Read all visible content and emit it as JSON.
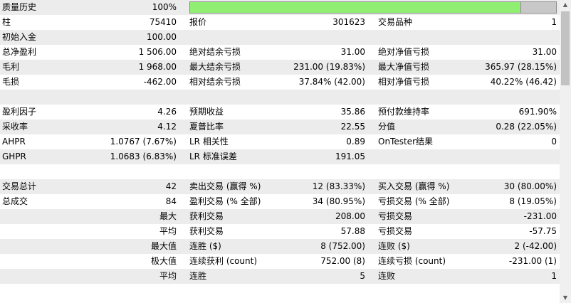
{
  "quality": {
    "label": "质量历史",
    "value": "100%",
    "fill": 0.905
  },
  "rows": [
    {
      "c1": [
        "柱",
        "75410"
      ],
      "c2": [
        "报价",
        "301623"
      ],
      "c3": [
        "交易品种",
        "1"
      ]
    },
    {
      "c1": [
        "初始入金",
        "100.00"
      ],
      "c2": [
        "",
        ""
      ],
      "c3": [
        "",
        ""
      ]
    },
    {
      "c1": [
        "总净盈利",
        "1 506.00"
      ],
      "c2": [
        "绝对结余亏损",
        "31.00"
      ],
      "c3": [
        "绝对净值亏损",
        "31.00"
      ]
    },
    {
      "c1": [
        "毛利",
        "1 968.00"
      ],
      "c2": [
        "最大结余亏损",
        "231.00 (19.83%)"
      ],
      "c3": [
        "最大净值亏损",
        "365.97 (28.15%)"
      ]
    },
    {
      "c1": [
        "毛损",
        "-462.00"
      ],
      "c2": [
        "相对结余亏损",
        "37.84% (42.00)"
      ],
      "c3": [
        "相对净值亏损",
        "40.22% (46.42)"
      ]
    },
    {
      "c1": [
        "",
        ""
      ],
      "c2": [
        "",
        ""
      ],
      "c3": [
        "",
        ""
      ]
    },
    {
      "c1": [
        "盈利因子",
        "4.26"
      ],
      "c2": [
        "预期收益",
        "35.86"
      ],
      "c3": [
        "预付款维持率",
        "691.90%"
      ]
    },
    {
      "c1": [
        "采收率",
        "4.12"
      ],
      "c2": [
        "夏普比率",
        "22.55"
      ],
      "c3": [
        "分值",
        "0.28 (22.05%)"
      ]
    },
    {
      "c1": [
        "AHPR",
        "1.0767 (7.67%)"
      ],
      "c2": [
        "LR 相关性",
        "0.89"
      ],
      "c3": [
        "OnTester结果",
        "0"
      ]
    },
    {
      "c1": [
        "GHPR",
        "1.0683 (6.83%)"
      ],
      "c2": [
        "LR 标准误差",
        "191.05"
      ],
      "c3": [
        "",
        ""
      ]
    },
    {
      "c1": [
        "",
        ""
      ],
      "c2": [
        "",
        ""
      ],
      "c3": [
        "",
        ""
      ]
    },
    {
      "c1": [
        "交易总计",
        "42"
      ],
      "c2": [
        "卖出交易 (赢得 %)",
        "12 (83.33%)"
      ],
      "c3": [
        "买入交易 (赢得 %)",
        "30 (80.00%)"
      ]
    },
    {
      "c1": [
        "总成交",
        "84"
      ],
      "c2": [
        "盈利交易 (% 全部)",
        "34 (80.95%)"
      ],
      "c3": [
        "亏损交易 (% 全部)",
        "8 (19.05%)"
      ]
    },
    {
      "c1": [
        "",
        "最大"
      ],
      "c2": [
        "获利交易",
        "208.00"
      ],
      "c3": [
        "亏损交易",
        "-231.00"
      ]
    },
    {
      "c1": [
        "",
        "平均"
      ],
      "c2": [
        "获利交易",
        "57.88"
      ],
      "c3": [
        "亏损交易",
        "-57.75"
      ]
    },
    {
      "c1": [
        "",
        "最大值"
      ],
      "c2": [
        "连胜 ($)",
        "8 (752.00)"
      ],
      "c3": [
        "连败 ($)",
        "2 (-42.00)"
      ]
    },
    {
      "c1": [
        "",
        "极大值"
      ],
      "c2": [
        "连续获利 (count)",
        "752.00 (8)"
      ],
      "c3": [
        "连续亏损 (count)",
        "-231.00 (1)"
      ]
    },
    {
      "c1": [
        "",
        "平均"
      ],
      "c2": [
        "连胜",
        "5"
      ],
      "c3": [
        "连败",
        "1"
      ]
    }
  ],
  "scroll": {
    "up_icon": "▲",
    "down_icon": "▼"
  }
}
